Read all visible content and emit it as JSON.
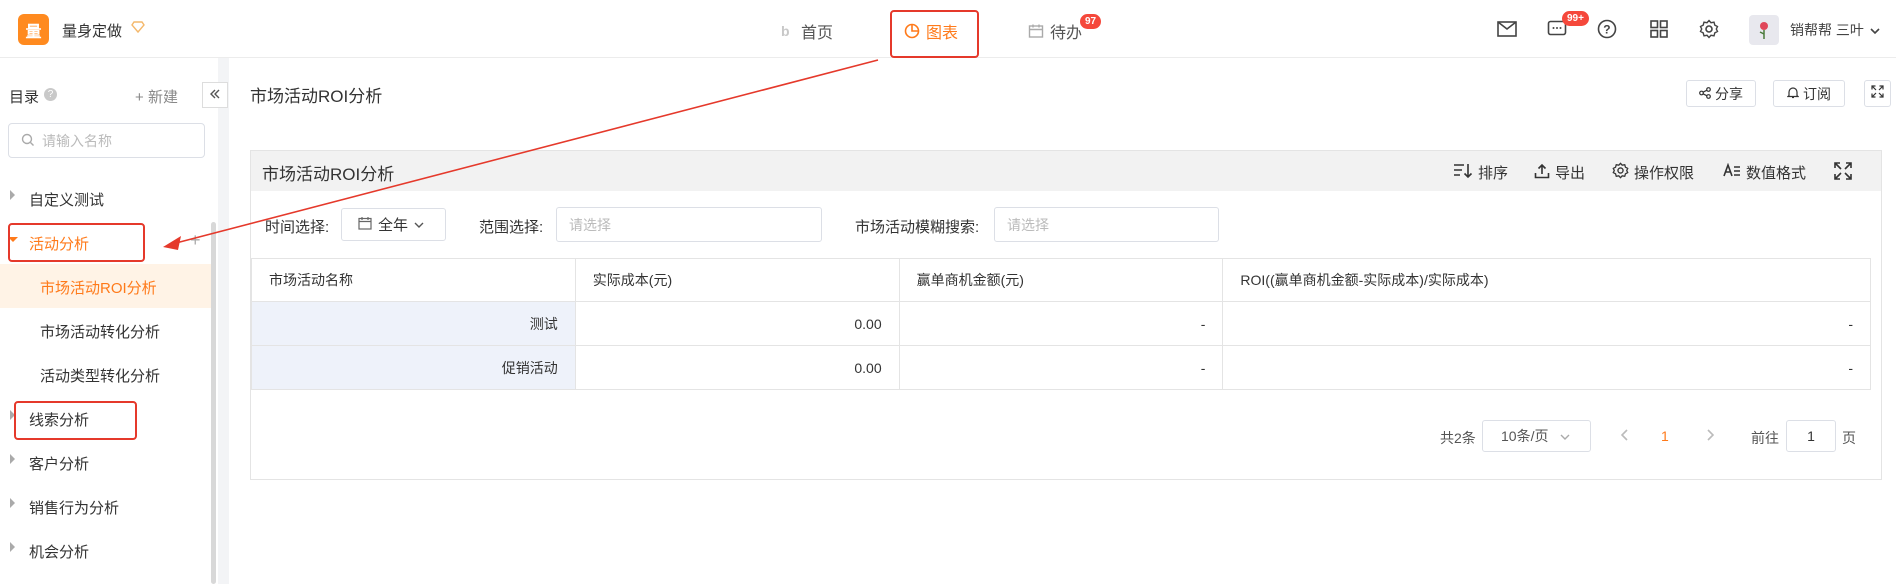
{
  "app": {
    "logo_char": "量",
    "brand": "量身定做"
  },
  "top_nav": [
    {
      "label": "首页"
    },
    {
      "label": "图表"
    },
    {
      "label": "待办",
      "badge": "97"
    }
  ],
  "header_right": {
    "chat_badge": "99+",
    "user_name": "销帮帮 三叶"
  },
  "sidebar": {
    "title": "目录",
    "help_mark": "?",
    "new_label": "新建",
    "search_placeholder": "请输入名称",
    "items": [
      {
        "label": "自定义测试"
      },
      {
        "label": "活动分析"
      },
      {
        "label": "市场活动ROI分析"
      },
      {
        "label": "市场活动转化分析"
      },
      {
        "label": "活动类型转化分析"
      },
      {
        "label": "线索分析"
      },
      {
        "label": "客户分析"
      },
      {
        "label": "销售行为分析"
      },
      {
        "label": "机会分析"
      }
    ]
  },
  "page": {
    "title": "市场活动ROI分析",
    "share_label": "分享",
    "subscribe_label": "订阅"
  },
  "panel": {
    "title": "市场活动ROI分析",
    "tools": {
      "sort": "排序",
      "export": "导出",
      "permission": "操作权限",
      "number_format": "数值格式"
    },
    "filters": {
      "time_label": "时间选择:",
      "time_value": "全年",
      "range_label": "范围选择:",
      "range_placeholder": "请选择",
      "search_label": "市场活动模糊搜索:",
      "search_placeholder": "请选择"
    },
    "table": {
      "columns": [
        "市场活动名称",
        "实际成本(元)",
        "赢单商机金额(元)",
        "ROI((赢单商机金额-实际成本)/实际成本)"
      ],
      "rows": [
        [
          "测试",
          "0.00",
          "-",
          "-"
        ],
        [
          "促销活动",
          "0.00",
          "-",
          "-"
        ]
      ]
    },
    "pagination": {
      "total": "共2条",
      "page_size": "10条/页",
      "current": "1",
      "goto_label": "前往",
      "goto_value": "1",
      "page_suffix": "页"
    }
  },
  "colors": {
    "accent": "#ff7a1a",
    "annotation": "#e5392b",
    "badge": "#f5483b"
  }
}
